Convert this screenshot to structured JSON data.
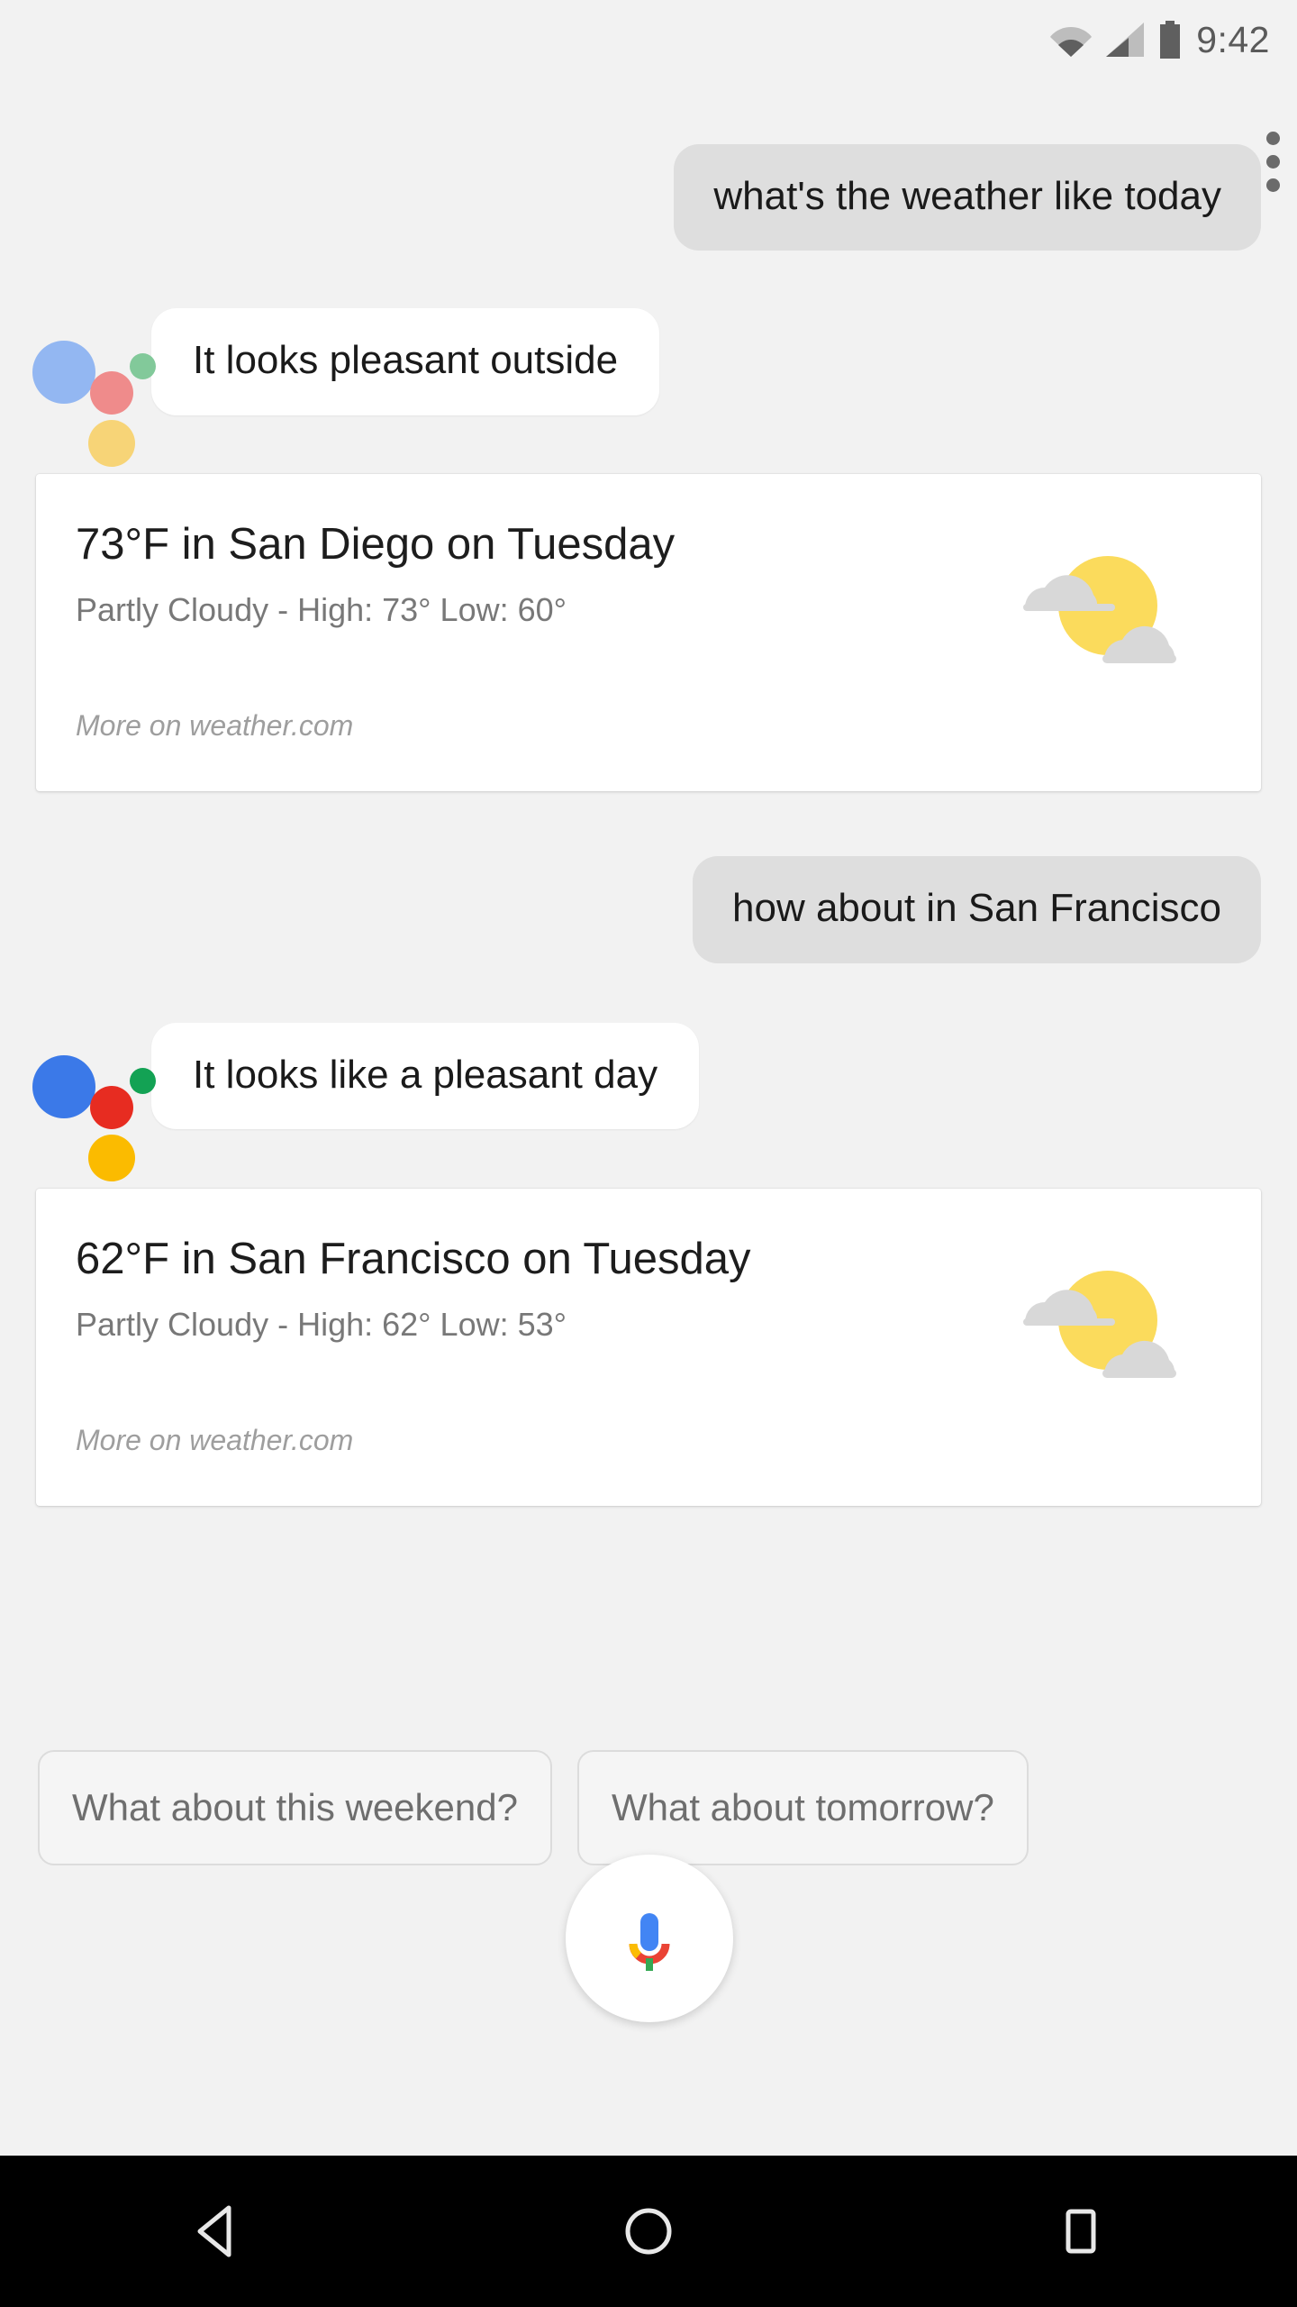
{
  "status_bar": {
    "time": "9:42",
    "icons": [
      "wifi-icon",
      "cellular-signal-icon",
      "battery-icon"
    ]
  },
  "conversation": [
    {
      "role": "user",
      "text": "what's the weather like today",
      "overflow_menu": "overflow-menu-icon"
    },
    {
      "role": "assistant",
      "text": "It looks pleasant outside",
      "logo": "google-assistant-logo"
    },
    {
      "role": "card",
      "title": "73°F in San Diego on Tuesday",
      "subtitle": "Partly Cloudy - High: 73° Low: 60°",
      "link": "More on weather.com",
      "icon": "partly-cloudy-icon"
    },
    {
      "role": "user",
      "text": "how about in San Francisco"
    },
    {
      "role": "assistant",
      "text": "It looks like a pleasant day",
      "logo": "google-assistant-logo"
    },
    {
      "role": "card",
      "title": "62°F in San Francisco on Tuesday",
      "subtitle": "Partly Cloudy - High: 62° Low: 53°",
      "link": "More on weather.com",
      "icon": "partly-cloudy-icon"
    }
  ],
  "messages": {
    "user_1": "what's the weather like today",
    "assistant_1": "It looks pleasant outside",
    "user_2": "how about in San Francisco",
    "assistant_2": "It looks like a pleasant day"
  },
  "cards": [
    {
      "title": "73°F in San Diego on Tuesday",
      "subtitle": "Partly Cloudy - High: 73° Low: 60°",
      "link": "More on weather.com",
      "temperature": "73°F",
      "location": "San Diego",
      "day": "Tuesday",
      "condition": "Partly Cloudy",
      "high": "73°",
      "low": "60°"
    },
    {
      "title": "62°F in San Francisco on Tuesday",
      "subtitle": "Partly Cloudy - High: 62° Low: 53°",
      "link": "More on weather.com",
      "temperature": "62°F",
      "location": "San Francisco",
      "day": "Tuesday",
      "condition": "Partly Cloudy",
      "high": "62°",
      "low": "53°"
    }
  ],
  "suggestions": [
    {
      "label": "What about this weekend?"
    },
    {
      "label": "What about tomorrow?"
    }
  ],
  "mic_button": {
    "icon": "microphone-icon"
  },
  "nav_bar": {
    "back": "back-triangle-icon",
    "home": "home-circle-icon",
    "recents": "recents-square-icon"
  },
  "colors": {
    "background": "#f2f2f2",
    "user_bubble": "#dedede",
    "assistant_bubble": "#ffffff",
    "card": "#ffffff",
    "google_blue": "#3b79e8",
    "google_red": "#e72c21",
    "google_yellow": "#fbbb00",
    "google_green": "#13a254",
    "sun_yellow": "#fbdb5c",
    "cloud_grey": "#d8d8d8",
    "navbar": "#000000"
  }
}
